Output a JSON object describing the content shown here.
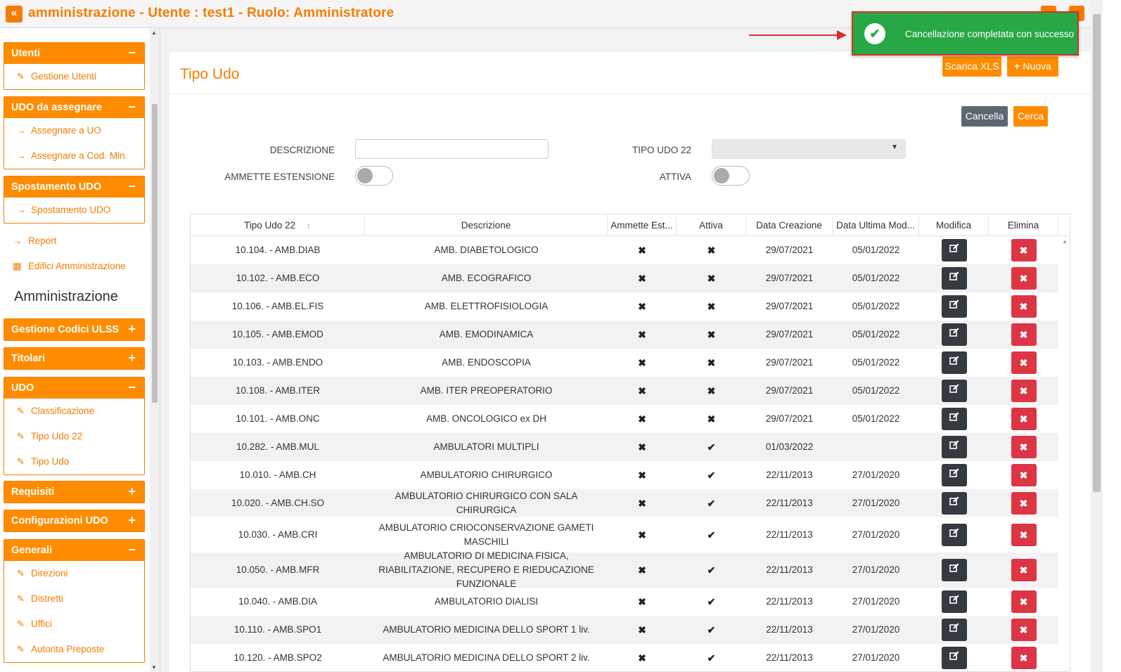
{
  "app": {
    "title": "amministrazione - Utente : test1 - Ruolo: Amministratore",
    "collapse_glyph": "«"
  },
  "sidebar": {
    "groups": [
      {
        "id": "utenti",
        "label": "Utenti",
        "toggle": "−",
        "items": [
          {
            "label": "Gestione Utenti",
            "icon": "user-edit-icon"
          }
        ]
      },
      {
        "id": "udo-assegnare",
        "label": "UDO da assegnare",
        "toggle": "−",
        "items": [
          {
            "label": "Assegnare a UO",
            "icon": "arrow-right-icon"
          },
          {
            "label": "Assegnare a Cod. Min.",
            "icon": "arrow-right-icon"
          }
        ]
      },
      {
        "id": "spostamento",
        "label": "Spostamento UDO",
        "toggle": "−",
        "items": [
          {
            "label": "Spostamento UDO",
            "icon": "arrow-right-icon"
          }
        ]
      },
      {
        "id": "codici-ulss",
        "label": "Gestione Codici ULSS",
        "toggle": "+",
        "items": []
      },
      {
        "id": "titolari",
        "label": "Titolari",
        "toggle": "+",
        "items": []
      },
      {
        "id": "udo",
        "label": "UDO",
        "toggle": "−",
        "items": [
          {
            "label": "Classificazione",
            "icon": "user-edit-icon"
          },
          {
            "label": "Tipo Udo 22",
            "icon": "user-edit-icon"
          },
          {
            "label": "Tipo Udo",
            "icon": "user-edit-icon"
          }
        ]
      },
      {
        "id": "requisiti",
        "label": "Requisiti",
        "toggle": "+",
        "items": []
      },
      {
        "id": "config-udo",
        "label": "Configurazioni UDO",
        "toggle": "+",
        "items": []
      },
      {
        "id": "generali",
        "label": "Generali",
        "toggle": "−",
        "items": [
          {
            "label": "Direzioni",
            "icon": "user-edit-icon"
          },
          {
            "label": "Distretti",
            "icon": "user-edit-icon"
          },
          {
            "label": "Uffici",
            "icon": "user-edit-icon"
          },
          {
            "label": "Autorita Preposte",
            "icon": "user-edit-icon"
          }
        ]
      }
    ],
    "loose_items": [
      {
        "label": "Report",
        "icon": "arrow-right-icon"
      },
      {
        "label": "Edifici Amministrazione",
        "icon": "building-icon"
      }
    ],
    "section_title": "Amministrazione"
  },
  "page": {
    "title": "Tipo Udo",
    "download_label": "Scarica XLS",
    "new_label": "Nuova",
    "cancel_label": "Cancella",
    "search_label": "Cerca"
  },
  "filters": {
    "descrizione_label": "DESCRIZIONE",
    "descrizione_value": "",
    "tipo_udo22_label": "TIPO UDO 22",
    "tipo_udo22_value": "",
    "ammette_label": "AMMETTE ESTENSIONE",
    "ammette_on": false,
    "attiva_label": "ATTIVA",
    "attiva_on": false
  },
  "table": {
    "columns": [
      "Tipo Udo 22",
      "Descrizione",
      "Ammette Est...",
      "Attiva",
      "Data Creazione",
      "Data Ultima Mod...",
      "Modifica",
      "Elimina"
    ],
    "sort_column": "Tipo Udo 22",
    "sort_glyph": "↑",
    "rows": [
      {
        "tipo": "10.104. - AMB.DIAB",
        "descr": "AMB. DIABETOLOGICO",
        "ammette": false,
        "attiva": false,
        "creazione": "29/07/2021",
        "modifica": "05/01/2022"
      },
      {
        "tipo": "10.102. - AMB.ECO",
        "descr": "AMB. ECOGRAFICO",
        "ammette": false,
        "attiva": false,
        "creazione": "29/07/2021",
        "modifica": "05/01/2022"
      },
      {
        "tipo": "10.106. - AMB.EL.FIS",
        "descr": "AMB. ELETTROFISIOLOGIA",
        "ammette": false,
        "attiva": false,
        "creazione": "29/07/2021",
        "modifica": "05/01/2022"
      },
      {
        "tipo": "10.105. - AMB.EMOD",
        "descr": "AMB. EMODINAMICA",
        "ammette": false,
        "attiva": false,
        "creazione": "29/07/2021",
        "modifica": "05/01/2022"
      },
      {
        "tipo": "10.103. - AMB.ENDO",
        "descr": "AMB. ENDOSCOPIA",
        "ammette": false,
        "attiva": false,
        "creazione": "29/07/2021",
        "modifica": "05/01/2022"
      },
      {
        "tipo": "10.108. - AMB.ITER",
        "descr": "AMB. ITER PREOPERATORIO",
        "ammette": false,
        "attiva": false,
        "creazione": "29/07/2021",
        "modifica": "05/01/2022"
      },
      {
        "tipo": "10.101. - AMB.ONC",
        "descr": "AMB. ONCOLOGICO ex DH",
        "ammette": false,
        "attiva": false,
        "creazione": "29/07/2021",
        "modifica": "05/01/2022"
      },
      {
        "tipo": "10.282. - AMB.MUL",
        "descr": "AMBULATORI MULTIPLI",
        "ammette": false,
        "attiva": true,
        "creazione": "01/03/2022",
        "modifica": ""
      },
      {
        "tipo": "10.010. - AMB.CH",
        "descr": "AMBULATORIO CHIRURGICO",
        "ammette": false,
        "attiva": true,
        "creazione": "22/11/2013",
        "modifica": "27/01/2020"
      },
      {
        "tipo": "10.020. - AMB.CH.SO",
        "descr": "AMBULATORIO CHIRURGICO CON SALA CHIRURGICA",
        "ammette": false,
        "attiva": true,
        "creazione": "22/11/2013",
        "modifica": "27/01/2020"
      },
      {
        "tipo": "10.030. - AMB.CRI",
        "descr": "AMBULATORIO CRIOCONSERVAZIONE GAMETI MASCHILI",
        "ammette": false,
        "attiva": true,
        "creazione": "22/11/2013",
        "modifica": "27/01/2020"
      },
      {
        "tipo": "10.050. - AMB.MFR",
        "descr": "AMBULATORIO DI MEDICINA FISICA, RIABILITAZIONE, RECUPERO E RIEDUCAZIONE FUNZIONALE",
        "ammette": false,
        "attiva": true,
        "creazione": "22/11/2013",
        "modifica": "27/01/2020"
      },
      {
        "tipo": "10.040. - AMB.DIA",
        "descr": "AMBULATORIO DIALISI",
        "ammette": false,
        "attiva": true,
        "creazione": "22/11/2013",
        "modifica": "27/01/2020"
      },
      {
        "tipo": "10.110. - AMB.SPO1",
        "descr": "AMBULATORIO MEDICINA DELLO SPORT 1 liv.",
        "ammette": false,
        "attiva": true,
        "creazione": "22/11/2013",
        "modifica": "27/01/2020"
      },
      {
        "tipo": "10.120. - AMB.SPO2",
        "descr": "AMBULATORIO MEDICINA DELLO SPORT 2 liv.",
        "ammette": false,
        "attiva": true,
        "creazione": "22/11/2013",
        "modifica": "27/01/2020"
      }
    ]
  },
  "toast": {
    "message": "Cancellazione completata con successo",
    "status_color": "#28a745",
    "highlight_color": "#d9302c"
  },
  "theme": {
    "accent": "#ff8c00",
    "danger": "#dc3545",
    "dark": "#343a40"
  }
}
